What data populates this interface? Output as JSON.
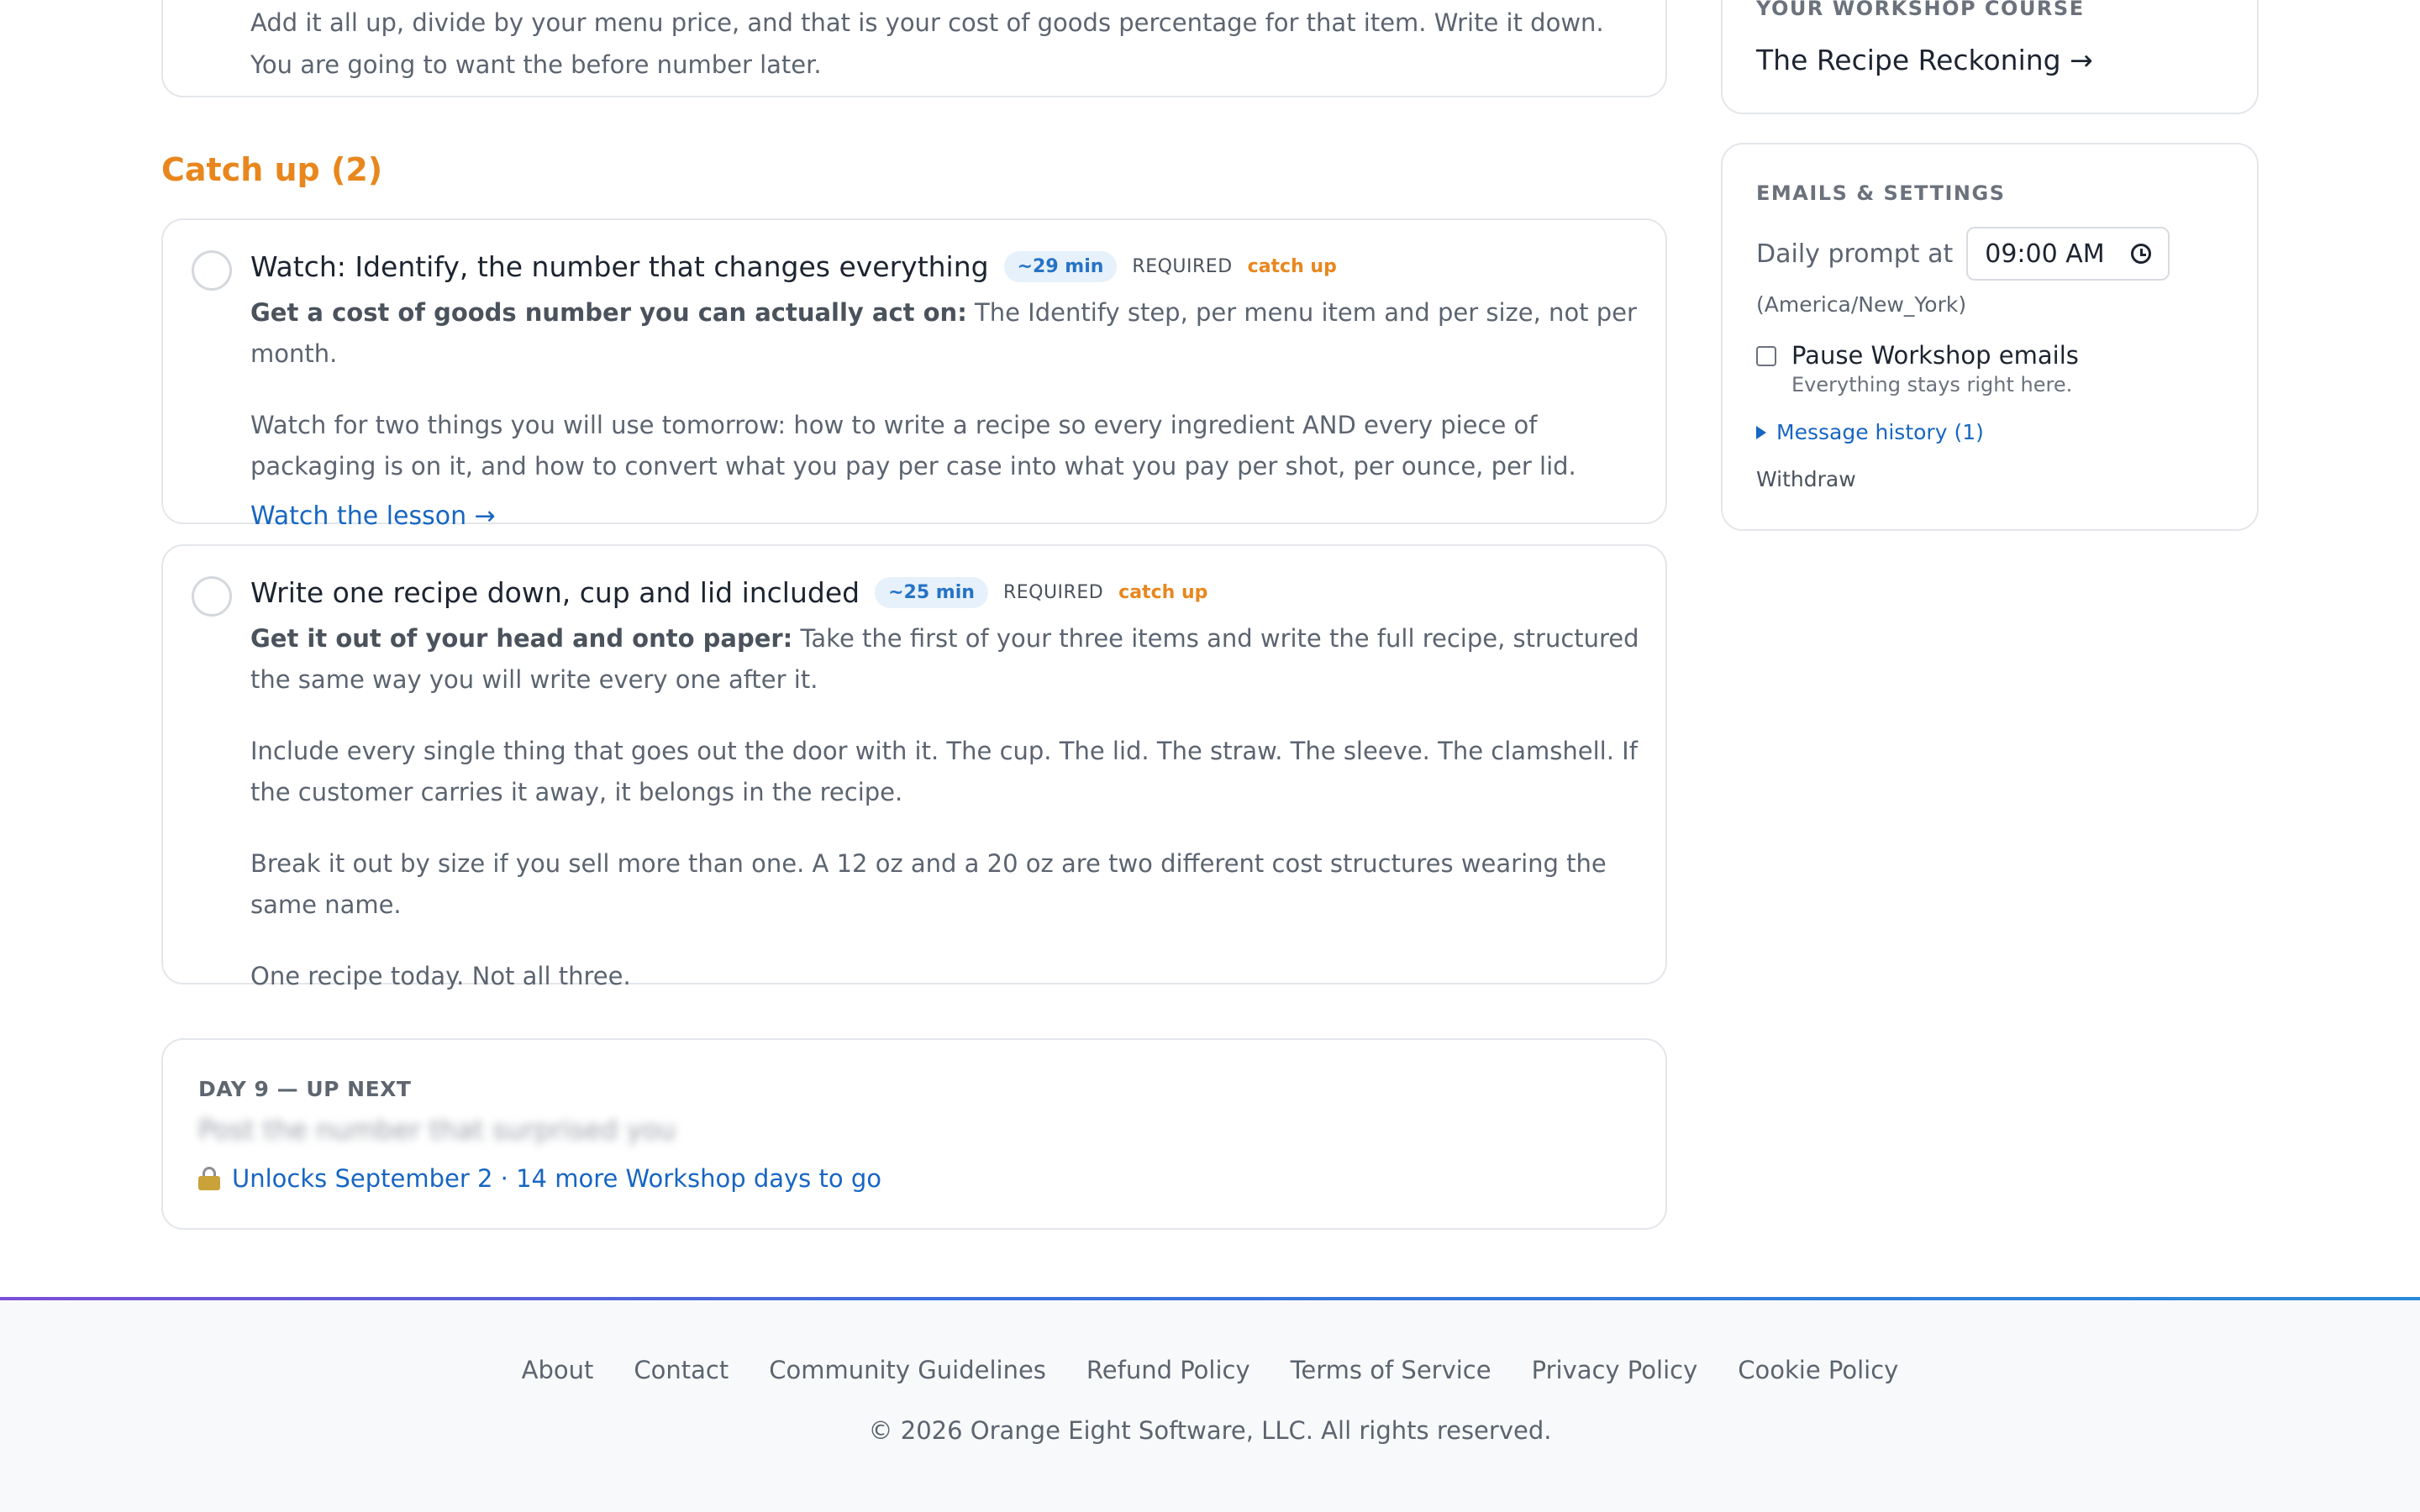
{
  "top_card": {
    "text": "Add it all up, divide by your menu price, and that is your cost of goods percentage for that item. Write it down. You are going to want the before number later."
  },
  "catch_up": {
    "title": "Catch up (2)",
    "lessons": [
      {
        "title": "Watch: Identify, the number that changes everything",
        "duration": "~29 min",
        "required": "REQUIRED",
        "tag": "catch up",
        "lead_bold": "Get a cost of goods number you can actually act on:",
        "lead_rest": " The Identify step, per menu item and per size, not per month.",
        "paragraphs": [
          "Watch for two things you will use tomorrow: how to write a recipe so every ingredient AND every piece of packaging is on it, and how to convert what you pay per case into what you pay per shot, per ounce, per lid."
        ],
        "link": "Watch the lesson →"
      },
      {
        "title": "Write one recipe down, cup and lid included",
        "duration": "~25 min",
        "required": "REQUIRED",
        "tag": "catch up",
        "lead_bold": "Get it out of your head and onto paper:",
        "lead_rest": " Take the first of your three items and write the full recipe, structured the same way you will write every one after it.",
        "paragraphs": [
          "Include every single thing that goes out the door with it. The cup. The lid. The straw. The sleeve. The clamshell. If the customer carries it away, it belongs in the recipe.",
          "Break it out by size if you sell more than one. A 12 oz and a 20 oz are two different cost structures wearing the same name.",
          "One recipe today. Not all three."
        ]
      }
    ]
  },
  "up_next": {
    "label": "DAY 9 — UP NEXT",
    "title_blurred": "Post the number that surprised you",
    "unlock_text": "Unlocks September 2 · 14 more Workshop days to go"
  },
  "sidebar": {
    "course_caption": "YOUR WORKSHOP COURSE",
    "course_title": "The Recipe Reckoning →",
    "settings_caption": "EMAILS & SETTINGS",
    "daily_prompt_label": "Daily prompt at",
    "daily_prompt_value": "09:00 AM",
    "timezone": "(America/New_York)",
    "pause_label": "Pause Workshop emails",
    "pause_sub": "Everything stays right here.",
    "history_label": "Message history (1)",
    "withdraw_label": "Withdraw"
  },
  "footer": {
    "links": [
      "About",
      "Contact",
      "Community Guidelines",
      "Refund Policy",
      "Terms of Service",
      "Privacy Policy",
      "Cookie Policy"
    ],
    "copyright": "© 2026 Orange Eight Software, LLC. All rights reserved."
  }
}
